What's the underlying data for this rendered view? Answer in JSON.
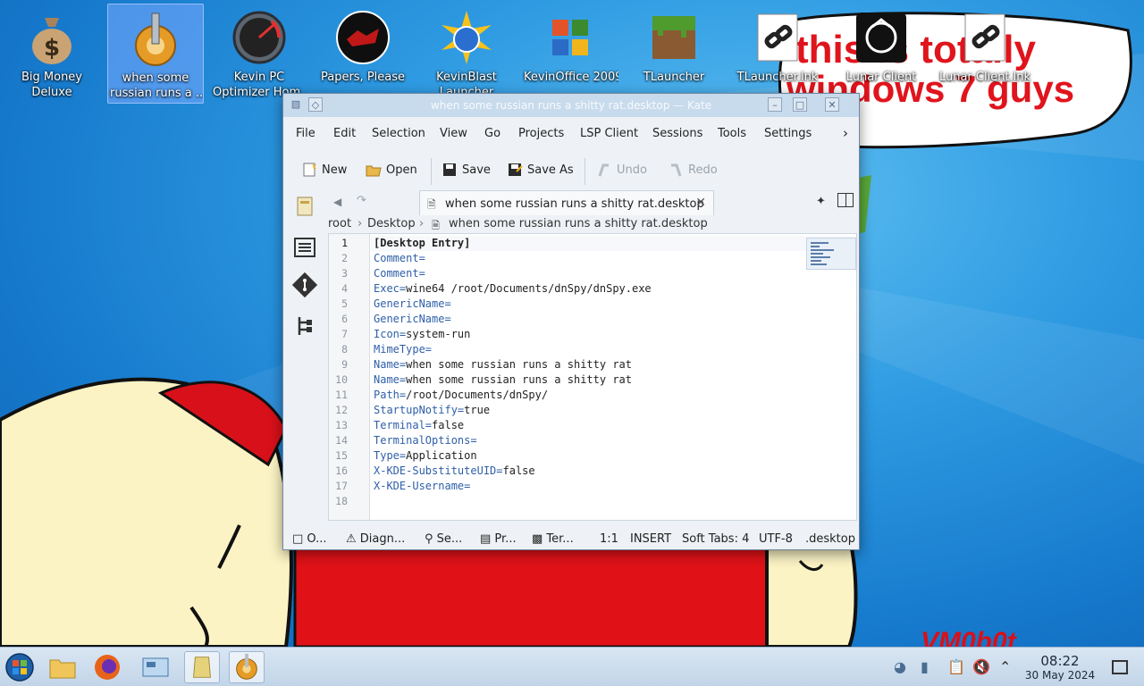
{
  "desktop": {
    "wallpaper": {
      "caption_line1": "this is totally",
      "caption_line2": "windows 7 guys",
      "signature": "VM0b0t",
      "colors": {
        "sky": "#1679cc",
        "red": "#e0141c",
        "yellow": "#fbf3c4"
      }
    },
    "icons": [
      {
        "label": "Big Money\nDeluxe",
        "icon": "money-bag-icon"
      },
      {
        "label": "when some\nrussian runs a ...",
        "icon": "gear-icon",
        "selected": true
      },
      {
        "label": "Kevin PC\nOptimizer Hom...",
        "icon": "speedometer-icon"
      },
      {
        "label": "Papers, Please",
        "icon": "papers-please-icon"
      },
      {
        "label": "KevinBlast\nLauncher",
        "icon": "globe-burst-icon"
      },
      {
        "label": "KevinOffice 2009",
        "icon": "office-icon"
      },
      {
        "label": "TLauncher",
        "icon": "grass-block-icon"
      },
      {
        "label": "TLauncher.lnk",
        "icon": "shortcut-link-icon"
      },
      {
        "label": "Lunar Client",
        "icon": "lunar-client-icon"
      },
      {
        "label": "Lunar Client.lnk",
        "icon": "shortcut-link-icon"
      }
    ]
  },
  "window": {
    "title": "when some russian runs a shitty rat.desktop — Kate",
    "menu": [
      "File",
      "Edit",
      "Selection",
      "View",
      "Go",
      "Projects",
      "LSP Client",
      "Sessions",
      "Tools",
      "Settings"
    ],
    "toolbar": {
      "new": "New",
      "open": "Open",
      "save": "Save",
      "save_as": "Save As",
      "undo": "Undo",
      "redo": "Redo"
    },
    "tab_label": "when some russian runs a shitty rat.desktop",
    "breadcrumb": [
      "root",
      "Desktop",
      "when some russian runs a shitty rat.desktop"
    ],
    "lines": [
      {
        "n": "1",
        "key": "[Desktop Entry]",
        "val": ""
      },
      {
        "n": "2",
        "key": "Comment=",
        "val": ""
      },
      {
        "n": "3",
        "key": "Comment=",
        "val": ""
      },
      {
        "n": "4",
        "key": "Exec=",
        "val": "wine64 /root/Documents/dnSpy/dnSpy.exe"
      },
      {
        "n": "5",
        "key": "GenericName=",
        "val": ""
      },
      {
        "n": "6",
        "key": "GenericName=",
        "val": ""
      },
      {
        "n": "7",
        "key": "Icon=",
        "val": "system-run"
      },
      {
        "n": "8",
        "key": "MimeType=",
        "val": ""
      },
      {
        "n": "9",
        "key": "Name=",
        "val": "when some russian runs a shitty rat"
      },
      {
        "n": "10",
        "key": "Name=",
        "val": "when some russian runs a shitty rat"
      },
      {
        "n": "11",
        "key": "Path=",
        "val": "/root/Documents/dnSpy/"
      },
      {
        "n": "12",
        "key": "StartupNotify=",
        "val": "true"
      },
      {
        "n": "13",
        "key": "Terminal=",
        "val": "false"
      },
      {
        "n": "14",
        "key": "TerminalOptions=",
        "val": ""
      },
      {
        "n": "15",
        "key": "Type=",
        "val": "Application"
      },
      {
        "n": "16",
        "key": "X-KDE-SubstituteUID=",
        "val": "false"
      },
      {
        "n": "17",
        "key": "X-KDE-Username=",
        "val": ""
      },
      {
        "n": "18",
        "key": "",
        "val": ""
      }
    ],
    "status": {
      "outline": "O...",
      "diagnostics": "Diagn...",
      "search": "Se...",
      "projects": "Pr...",
      "terminal": "Ter...",
      "cursor": "1:1",
      "mode": "INSERT",
      "indent": "Soft Tabs: 4",
      "encoding": "UTF-8",
      "filetype": ".desktop"
    }
  },
  "taskbar": {
    "time": "08:22",
    "date": "30 May 2024"
  }
}
